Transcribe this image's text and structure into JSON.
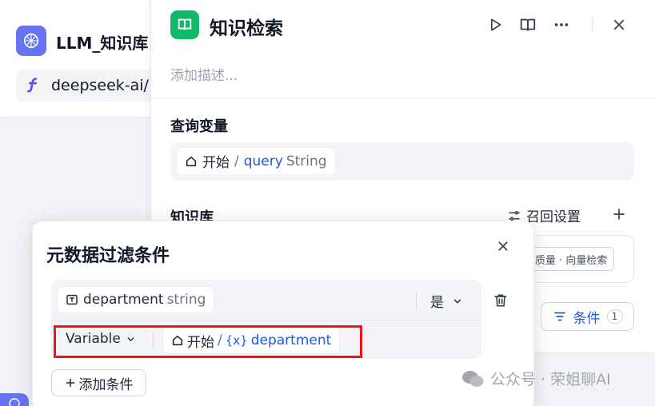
{
  "llm_node": {
    "title": "LLM_知识库",
    "model": "deepseek-ai/"
  },
  "panel": {
    "title": "知识检索",
    "description_placeholder": "添加描述...",
    "query_section": {
      "title": "查询变量",
      "variable": {
        "source": "开始",
        "separator": "/",
        "name": "query",
        "type": "String"
      }
    },
    "kb_section": {
      "title": "知识库",
      "recall_settings": "召回设置",
      "tag": "质量 · 向量检索",
      "conditions_button": "条件",
      "conditions_count": "1"
    }
  },
  "filter_popup": {
    "title": "元数据过滤条件",
    "condition": {
      "field_name": "department",
      "field_type": "string",
      "operator": "是",
      "value_mode": "Variable",
      "value_source": "开始",
      "value_separator": "/",
      "value_var_prefix": "{x}",
      "value_var_name": "department"
    },
    "add_condition": "添加条件"
  },
  "watermark": "公众号 · 荣姐聊AI",
  "colors": {
    "llm_accent": "#6673f3",
    "kb_accent": "#12b76a",
    "link_blue": "#1d5bd8",
    "highlight_red": "#f01414"
  }
}
